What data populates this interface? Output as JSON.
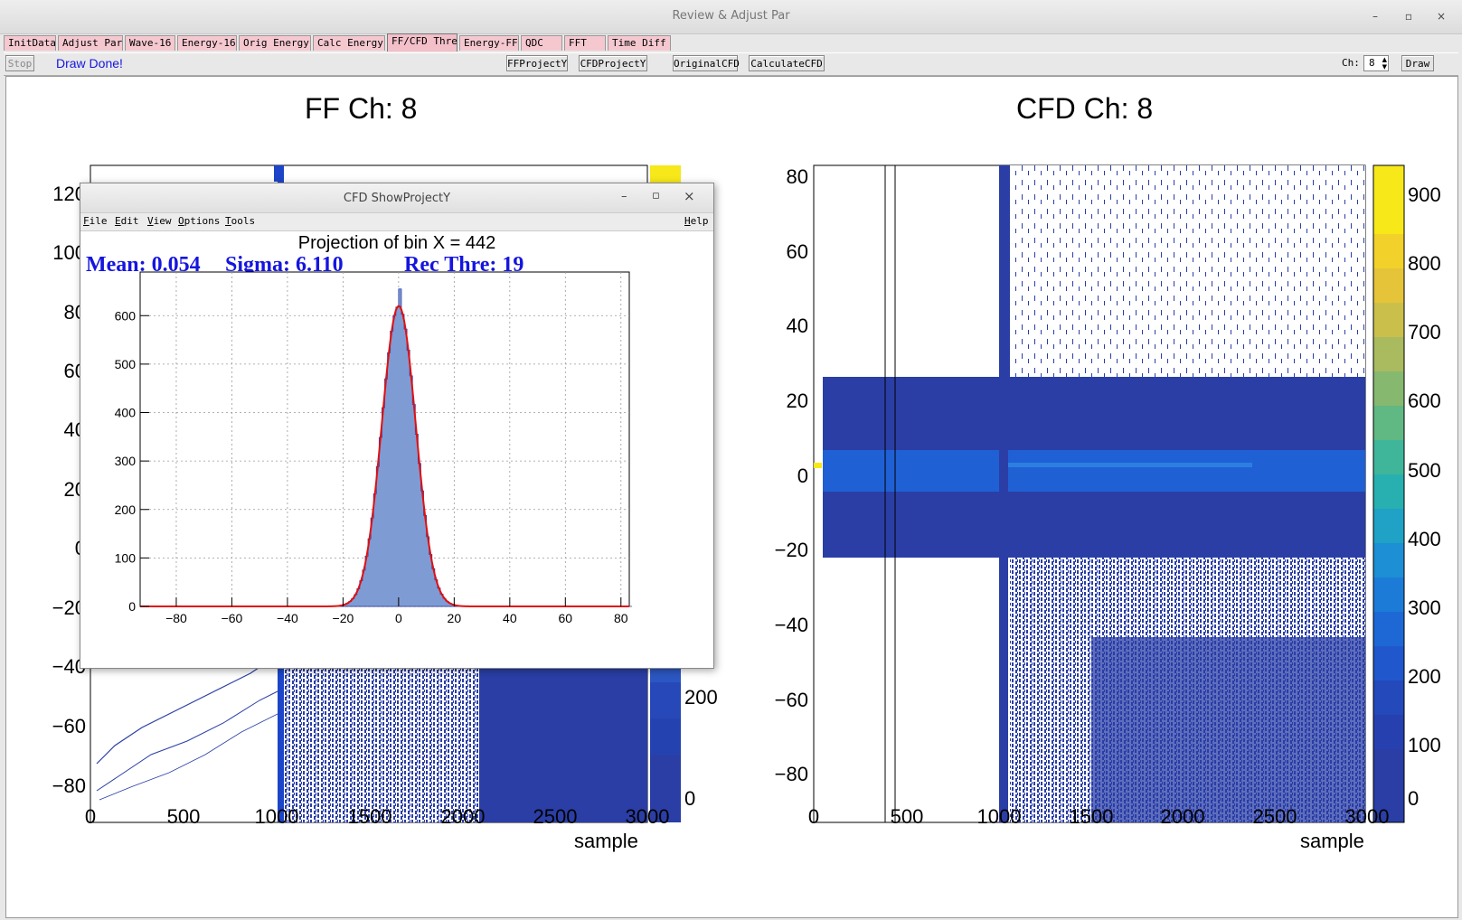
{
  "window": {
    "title": "Review & Adjust Par",
    "controls": {
      "minimize": "–",
      "maximize": "▫",
      "close": "×"
    }
  },
  "tabs": [
    {
      "label": "InitData"
    },
    {
      "label": "Adjust Par"
    },
    {
      "label": "Wave-16"
    },
    {
      "label": "Energy-16"
    },
    {
      "label": "Orig Energy"
    },
    {
      "label": "Calc Energy"
    },
    {
      "label": "FF/CFD Thre",
      "active": true
    },
    {
      "label": "Energy-FF"
    },
    {
      "label": "QDC"
    },
    {
      "label": "FFT"
    },
    {
      "label": "Time Diff"
    }
  ],
  "toolbar": {
    "stop_label": "Stop",
    "status_text": "Draw Done!",
    "ff_project_label": "FFProjectY",
    "cfd_project_label": "CFDProjectY",
    "original_cfd_label": "OriginalCFD",
    "calculate_cfd_label": "CalculateCFD",
    "ch_label": "Ch:",
    "ch_value": "8",
    "draw_label": "Draw"
  },
  "ff_panel": {
    "title": "FF  Ch: 8",
    "xlabel": "sample",
    "x_ticks": [
      "0",
      "500",
      "1000",
      "1500",
      "2000",
      "2500",
      "3000"
    ],
    "y_ticks_visible": [
      "120",
      "100",
      "80",
      "60",
      "40",
      "20",
      "0",
      "−20",
      "−40",
      "−60",
      "−80"
    ],
    "z_ticks_visible": [
      "200",
      "0"
    ]
  },
  "cfd_panel": {
    "title": "CFD  Ch: 8",
    "xlabel": "sample",
    "x_ticks": [
      "0",
      "500",
      "1000",
      "1500",
      "2000",
      "2500",
      "3000"
    ],
    "y_ticks": [
      "80",
      "60",
      "40",
      "20",
      "0",
      "−20",
      "−40",
      "−60",
      "−80"
    ],
    "z_ticks": [
      "900",
      "800",
      "700",
      "600",
      "500",
      "400",
      "300",
      "200",
      "100",
      "0"
    ]
  },
  "popup": {
    "title": "CFD ShowProjectY",
    "menu": [
      "File",
      "Edit",
      "View",
      "Options",
      "Tools"
    ],
    "help": "Help",
    "controls": {
      "minimize": "–",
      "maximize": "▫",
      "close": "×"
    },
    "projection_title": "Projection of bin X = 442",
    "mean_text": "Mean: 0.054",
    "sigma_text": "Sigma: 6.110",
    "thre_text": "Rec Thre: 19"
  },
  "chart_data": [
    {
      "type": "heatmap",
      "title": "FF  Ch: 8",
      "xlabel": "sample",
      "ylabel": "",
      "xlim": [
        0,
        3000
      ],
      "ylim": [
        -90,
        125
      ],
      "zlim": [
        0,
        300
      ],
      "grid": false
    },
    {
      "type": "heatmap",
      "title": "CFD  Ch: 8",
      "xlabel": "sample",
      "ylabel": "",
      "xlim": [
        0,
        3000
      ],
      "ylim": [
        -93,
        83
      ],
      "zlim": [
        0,
        950
      ],
      "grid": false
    },
    {
      "type": "bar",
      "title": "Projection of bin X = 442",
      "xlabel": "",
      "ylabel": "",
      "xlim": [
        -93,
        83
      ],
      "ylim": [
        0,
        690
      ],
      "x_ticks": [
        -80,
        -60,
        -40,
        -20,
        0,
        20,
        40,
        60,
        80
      ],
      "y_ticks": [
        0,
        100,
        200,
        300,
        400,
        500,
        600
      ],
      "grid": true,
      "fit": {
        "type": "gaussian",
        "mean": 0.054,
        "sigma": 6.11,
        "peak": 620
      },
      "histogram_peak_value": 655,
      "threshold": 19
    }
  ]
}
